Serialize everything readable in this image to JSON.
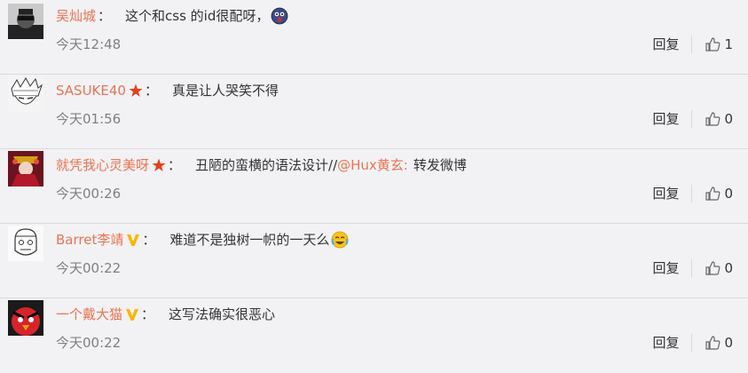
{
  "comments": [
    {
      "username": "吴灿城",
      "badge": "none",
      "text": "这个和css 的id很配呀，",
      "mention": "",
      "suffix": "",
      "emoji": "shocked-face-icon",
      "time": "今天12:48",
      "reply_label": "回复",
      "likes": "1"
    },
    {
      "username": "SASUKE40",
      "badge": "star",
      "text": "真是让人哭笑不得",
      "mention": "",
      "suffix": "",
      "emoji": "",
      "time": "今天01:56",
      "reply_label": "回复",
      "likes": "0"
    },
    {
      "username": "就凭我心灵美呀",
      "badge": "star",
      "text": "丑陋的蛮横的语法设计//",
      "mention": "@Hux黄玄:",
      "suffix": "转发微博",
      "emoji": "",
      "time": "今天00:26",
      "reply_label": "回复",
      "likes": "0"
    },
    {
      "username": "Barret李靖",
      "badge": "v",
      "text": "难道不是独树一帜的一天么",
      "mention": "",
      "suffix": "",
      "emoji": "laugh-cry-icon",
      "time": "今天00:22",
      "reply_label": "回复",
      "likes": "0"
    },
    {
      "username": "一个戴大猫",
      "badge": "v",
      "text": "这写法确实很恶心",
      "mention": "",
      "suffix": "",
      "emoji": "",
      "time": "今天00:22",
      "reply_label": "回复",
      "likes": "0"
    }
  ],
  "colors": {
    "username": "#eb7350",
    "time": "#808080",
    "star_badge": "#e8401c",
    "v_badge": "#ffb400"
  },
  "colon": "："
}
